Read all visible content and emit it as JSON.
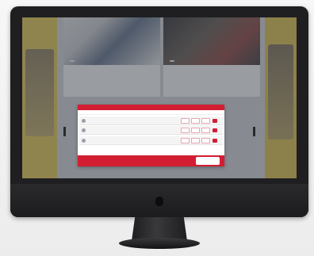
{
  "device": {
    "name": "iMac Pro"
  },
  "site": {
    "promo_left": {
      "text": ""
    },
    "promo_right": {
      "text": ""
    },
    "articles": [
      {
        "tag": "",
        "headline": "",
        "mark": ""
      },
      {
        "tag": "",
        "headline": "",
        "mark": ""
      }
    ]
  },
  "modal": {
    "title": "",
    "subtitle": "",
    "matches": [
      {
        "home": "",
        "away": "",
        "odds": [
          "",
          "",
          ""
        ]
      },
      {
        "home": "",
        "away": "",
        "odds": [
          "",
          "",
          ""
        ]
      },
      {
        "home": "",
        "away": "",
        "odds": [
          "",
          "",
          ""
        ]
      }
    ],
    "footer_label": "",
    "brand": "",
    "colors": {
      "accent": "#d31e32",
      "highlight": "#e5c444"
    }
  },
  "icons": {
    "logo": "apple-logo-icon",
    "bet": "bet-slip-icon",
    "team": "team-crest-icon"
  }
}
